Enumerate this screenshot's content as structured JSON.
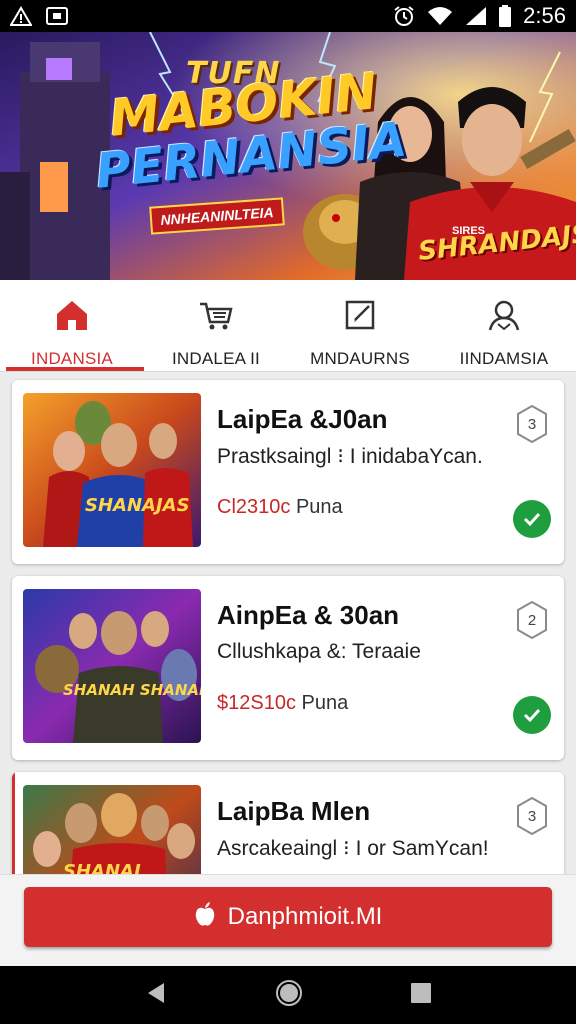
{
  "status_bar": {
    "time": "2:56",
    "icons": [
      "warning-icon",
      "screen-cast-icon",
      "alarm-icon",
      "wifi-icon",
      "signal-icon",
      "battery-icon"
    ]
  },
  "banner": {
    "line1": "TUFN",
    "line2": "MABOKIN",
    "line3": "PERNANSIA",
    "ribbon": "NNHEANINLTEIA",
    "jersey_small": "SIRES",
    "jersey": "SHRANDAJS"
  },
  "tabs": [
    {
      "label": "INDANSIA",
      "icon": "home-icon",
      "active": true
    },
    {
      "label": "INDALEA II",
      "icon": "cart-icon",
      "active": false
    },
    {
      "label": "MNDAURNS",
      "icon": "edit-icon",
      "active": false
    },
    {
      "label": "IINDAMSIA",
      "icon": "profile-icon",
      "active": false
    }
  ],
  "items": [
    {
      "title": "LaipEa &J0an",
      "subtitle": "Prastksaingl ⁝ I inidabaYcan.",
      "price_amount": "Cl2310c",
      "price_suffix": "Puna",
      "badge": "3",
      "checked": true,
      "thumb_text": "SHANAJAS"
    },
    {
      "title": "AinpEa & 30an",
      "subtitle": "Cllushkapa &: Teraaie",
      "price_amount": "$12S10c",
      "price_suffix": "Puna",
      "badge": "2",
      "checked": true,
      "thumb_text": "SHANAH SHANAN"
    },
    {
      "title": "LaipBa Mlen",
      "subtitle": "Asrcakeaingl ⁝ I or SamYcan!",
      "badge": "3",
      "checked": false,
      "thumb_text": "SHANAJ"
    }
  ],
  "cta": {
    "label": "Danphmioit.MI",
    "icon": "apple-icon"
  },
  "colors": {
    "accent": "#d32f2f",
    "check": "#1e9e3e"
  }
}
